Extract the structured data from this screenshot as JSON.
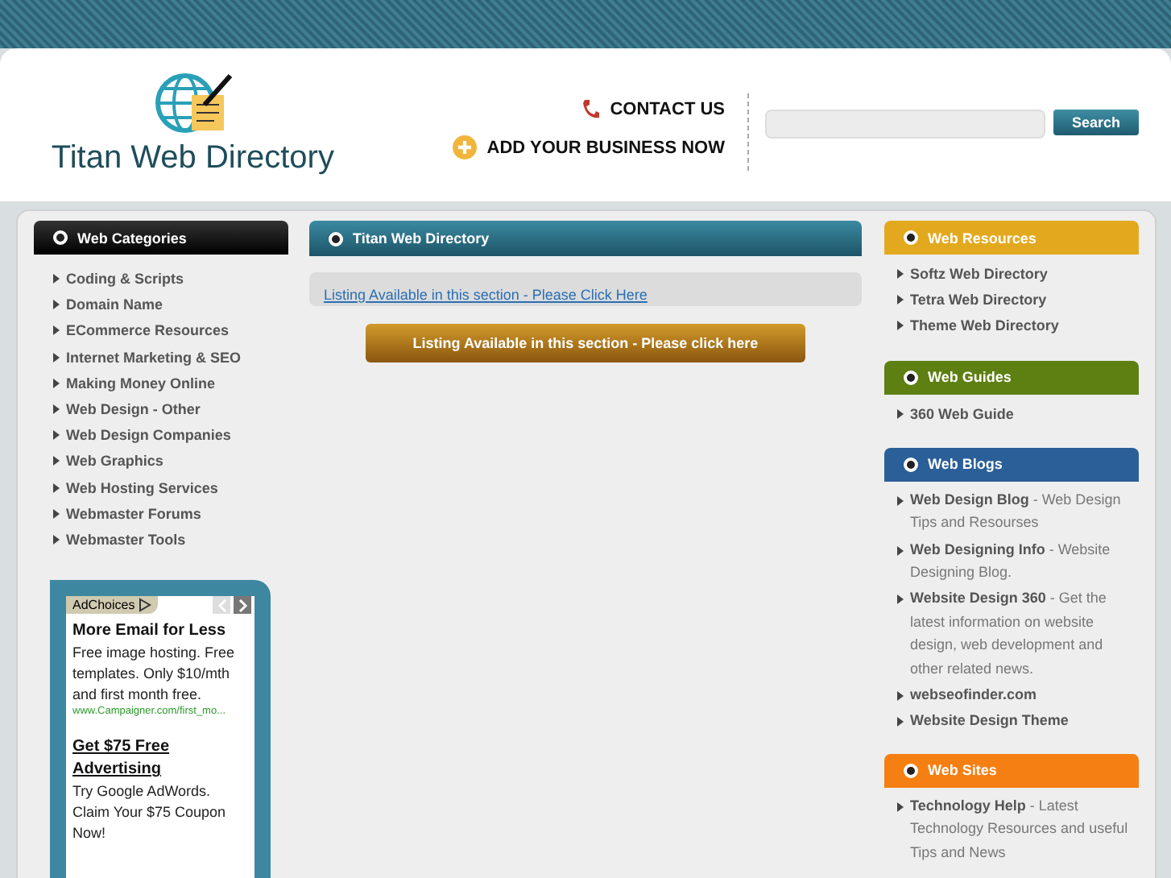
{
  "header": {
    "site_title": "Titan Web Directory",
    "contact": "CONTACT US",
    "add_business": "ADD YOUR BUSINESS NOW",
    "search_button": "Search"
  },
  "categories": {
    "title": "Web Categories",
    "items": [
      "Coding & Scripts",
      "Domain Name",
      "ECommerce Resources",
      "Internet Marketing & SEO",
      "Making Money Online",
      "Web Design - Other",
      "Web Design Companies",
      "Web Graphics",
      "Web Hosting Services",
      "Webmaster Forums",
      "Webmaster Tools"
    ]
  },
  "ad": {
    "adchoices": "AdChoices",
    "ads": [
      {
        "title": "More Email for Less",
        "title_underlined": false,
        "body": "Free image hosting. Free templates. Only $10/mth and first month free.",
        "url": "www.Campaigner.com/first_mo..."
      },
      {
        "title": "Get $75 Free Advertising",
        "title_underlined": true,
        "body": "Try Google AdWords. Claim Your $75 Coupon Now!"
      }
    ]
  },
  "main": {
    "title": "Titan Web Directory",
    "notice_link": "Listing Available in this section - Please Click Here",
    "listing_button": "Listing Available in this section - Please click here"
  },
  "right_boxes": [
    {
      "title": "Web Resources",
      "color": "#e3a91e",
      "items": [
        "Softz Web Directory",
        "Tetra Web Directory",
        "Theme Web Directory"
      ]
    },
    {
      "title": "Web Guides",
      "color": "#5e7f12",
      "items": [
        "360 Web Guide"
      ]
    },
    {
      "title": "Web Blogs",
      "color": "#2a5f98",
      "items": [
        "**Web Design Blog** - Web Design Tips and Resourses",
        "**Web Designing Info** - Website Designing Blog.",
        "**Website Design 360** - Get the latest information on website design, web development and other related news.",
        "**webseofinder.com**",
        "**Website Design Theme**"
      ]
    },
    {
      "title": "Web Sites",
      "color": "#f57f12",
      "items": [
        "**Technology Help** - Latest Technology Resources and useful Tips and News"
      ]
    }
  ]
}
